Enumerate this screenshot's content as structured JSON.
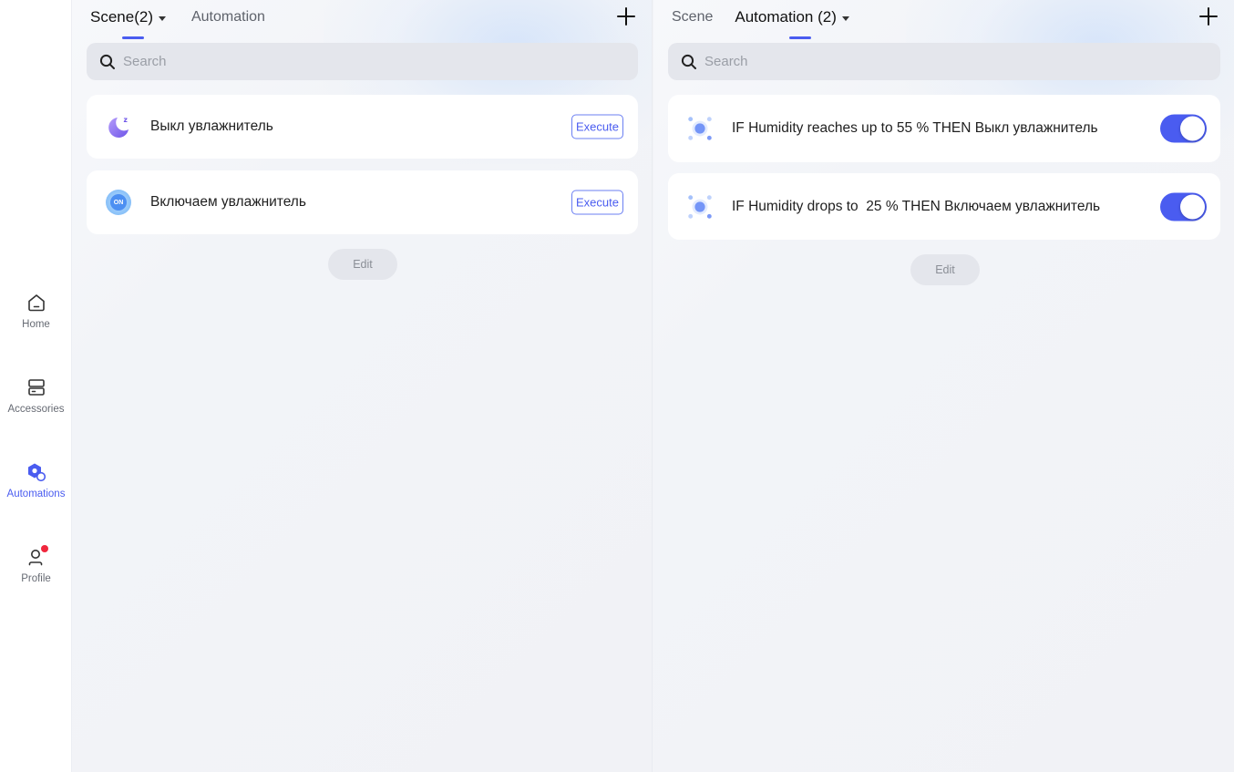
{
  "sidebar": {
    "items": [
      {
        "label": "Home",
        "icon": "home-icon",
        "active": false
      },
      {
        "label": "Accessories",
        "icon": "accessories-icon",
        "active": false
      },
      {
        "label": "Automations",
        "icon": "automations-icon",
        "active": true
      },
      {
        "label": "Profile",
        "icon": "profile-icon",
        "active": false,
        "badge": true
      }
    ]
  },
  "left_panel": {
    "tabs": [
      {
        "label": "Scene(2)",
        "active": true
      },
      {
        "label": "Automation",
        "active": false
      }
    ],
    "search_placeholder": "Search",
    "scenes": [
      {
        "label": "Выкл увлажнитель",
        "icon": "moon-sleep-icon",
        "button": "Execute"
      },
      {
        "label": "Включаем увлажнитель",
        "icon": "on-icon",
        "icon_text": "ON",
        "button": "Execute"
      }
    ],
    "edit_label": "Edit"
  },
  "right_panel": {
    "tabs": [
      {
        "label": "Scene",
        "active": false
      },
      {
        "label": "Automation (2)",
        "active": true
      }
    ],
    "search_placeholder": "Search",
    "automations": [
      {
        "label": "IF Humidity reaches up to 55 % THEN Выкл увлажнитель",
        "icon": "automation-dots-icon",
        "enabled": true
      },
      {
        "label": "IF Humidity drops to  25 % THEN Включаем увлажнитель",
        "icon": "automation-dots-icon",
        "enabled": true
      }
    ],
    "edit_label": "Edit"
  },
  "colors": {
    "accent": "#4a5cf0",
    "badge": "#f0273d",
    "background": "#f2f3f7"
  }
}
